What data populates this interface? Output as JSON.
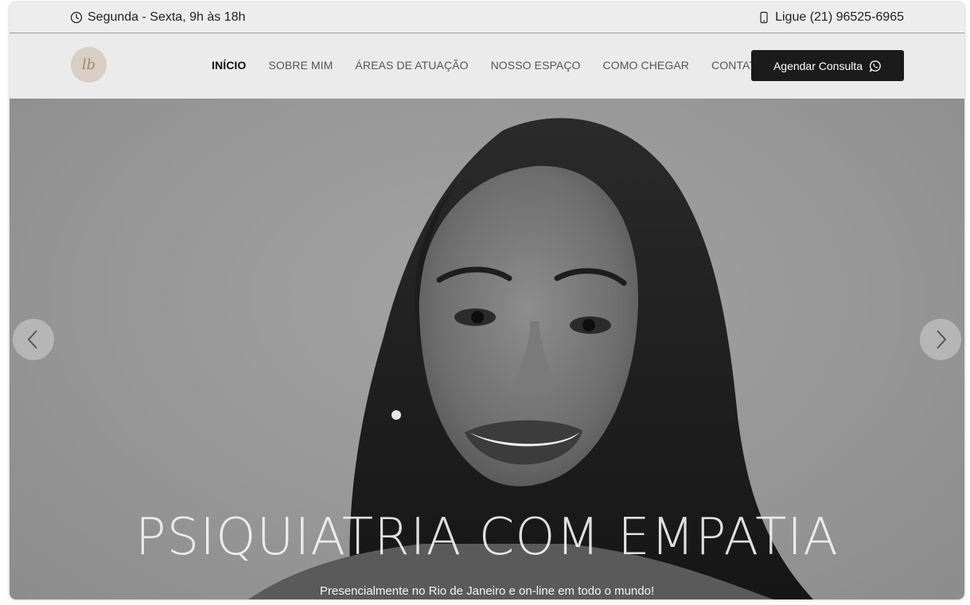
{
  "topbar": {
    "hours_icon": "clock-icon",
    "hours": "Segunda - Sexta, 9h às 18h",
    "phone_icon": "phone-icon",
    "phone": "Ligue (21) 96525-6965"
  },
  "header": {
    "logo_text": "lb",
    "nav": [
      {
        "label": "INÍCIO",
        "active": true
      },
      {
        "label": "SOBRE MIM"
      },
      {
        "label": "ÁREAS DE ATUAÇÃO"
      },
      {
        "label": "NOSSO ESPAÇO"
      },
      {
        "label": "COMO CHEGAR"
      },
      {
        "label": "CONTATOS"
      }
    ],
    "cta_label": "Agendar Consulta",
    "cta_icon": "whatsapp-icon"
  },
  "hero": {
    "headline": "PSIQUIATRIA COM EMPATIA",
    "subheadline": "Presencialmente no Rio de Janeiro e on-line em todo o mundo!",
    "prev_icon": "chevron-left-icon",
    "next_icon": "chevron-right-icon"
  },
  "colors": {
    "cta_background": "#1b1b1b",
    "logo_background": "#d9cec4",
    "header_background": "#ebebeb"
  }
}
